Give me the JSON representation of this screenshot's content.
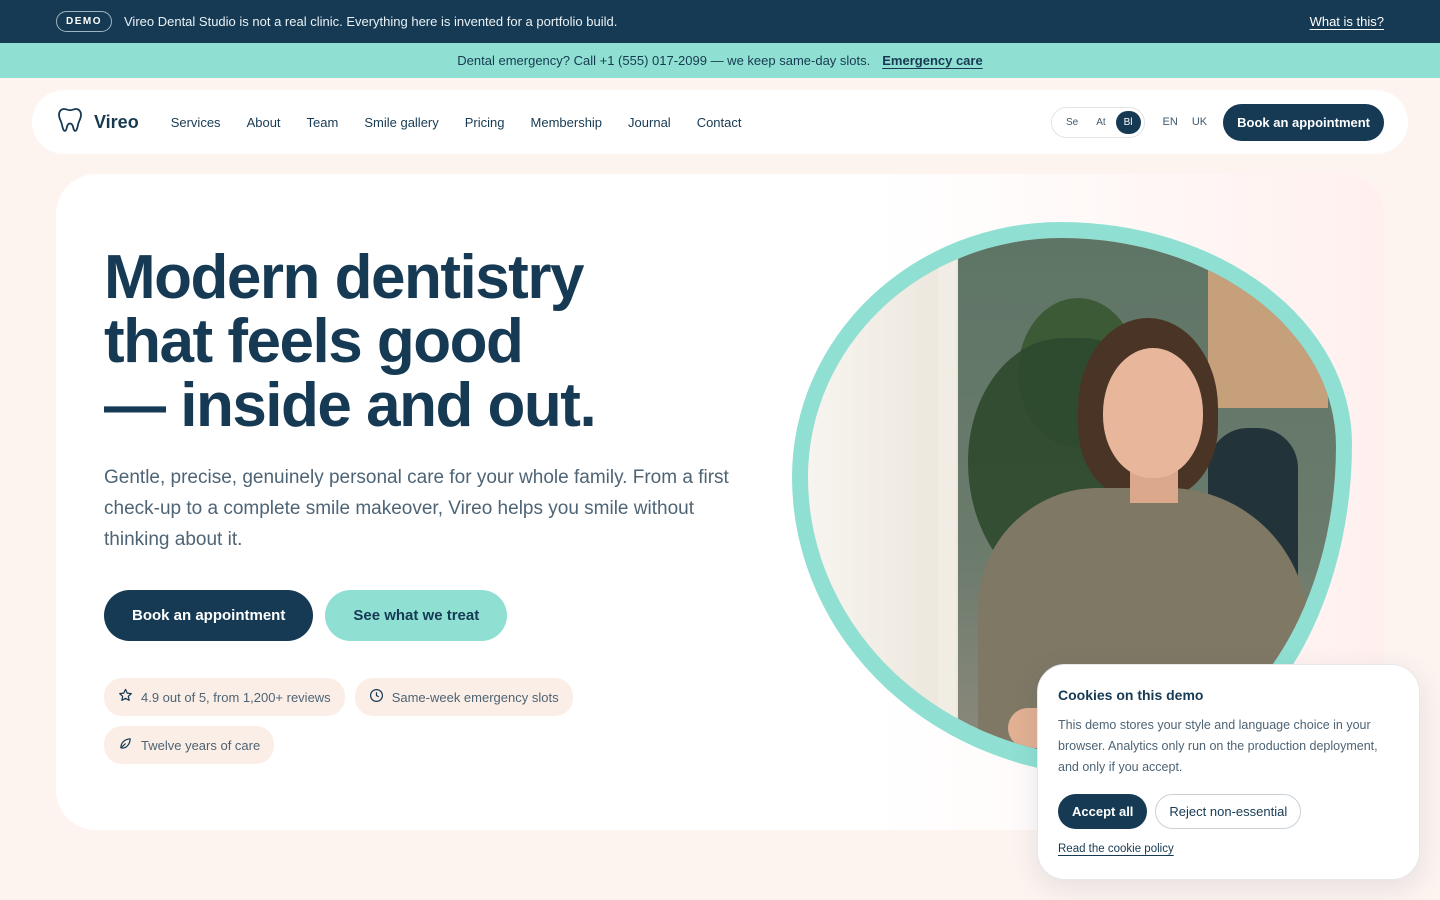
{
  "colors": {
    "navy": "#163a54",
    "mint": "#8fe0d2",
    "cream": "#fdf3ef",
    "badge_bg": "#fbeee6"
  },
  "demo_bar": {
    "badge": "DEMO",
    "notice": "Vireo Dental Studio is not a real clinic. Everything here is invented for a portfolio build.",
    "link": "What is this?"
  },
  "emergency_bar": {
    "text": "Dental emergency? Call +1 (555) 017-2099 — we keep same-day slots.",
    "link": "Emergency care"
  },
  "nav": {
    "logo_icon": "tooth-icon",
    "brand": "Vireo",
    "links": [
      "Services",
      "About",
      "Team",
      "Smile gallery",
      "Pricing",
      "Membership",
      "Journal",
      "Contact"
    ],
    "style_options": [
      "Se",
      "At",
      "Bl"
    ],
    "style_selected": "Bl",
    "languages": [
      "EN",
      "UK"
    ],
    "cta": "Book an appointment"
  },
  "hero": {
    "title_lines": [
      "Modern dentistry",
      "that feels good",
      "— inside and out."
    ],
    "lead": "Gentle, precise, genuinely personal care for your whole family. From a first check-up to a complete smile makeover, Vireo helps you smile without thinking about it.",
    "primary_cta": "Book an appointment",
    "secondary_cta": "See what we treat",
    "badges": [
      {
        "icon": "star-icon",
        "label": "4.9 out of 5, from 1,200+ reviews"
      },
      {
        "icon": "clock-icon",
        "label": "Same-week emergency slots"
      },
      {
        "icon": "leaf-icon",
        "label": "Twelve years of care"
      }
    ]
  },
  "cookie": {
    "title": "Cookies on this demo",
    "text": "This demo stores your style and language choice in your browser. Analytics only run on the production deployment, and only if you accept.",
    "accept": "Accept all",
    "reject": "Reject non-essential",
    "policy": "Read the cookie policy"
  }
}
